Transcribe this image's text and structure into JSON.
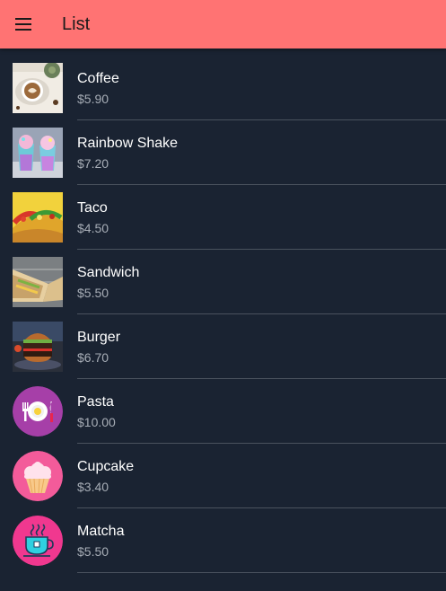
{
  "appbar": {
    "title": "List",
    "menu_icon": "hamburger-menu-icon",
    "background": "#ff7373"
  },
  "items": [
    {
      "name": "Coffee",
      "price": "$5.90",
      "thumb": "coffee-photo"
    },
    {
      "name": "Rainbow Shake",
      "price": "$7.20",
      "thumb": "rainbow-shake-photo"
    },
    {
      "name": "Taco",
      "price": "$4.50",
      "thumb": "taco-photo"
    },
    {
      "name": "Sandwich",
      "price": "$5.50",
      "thumb": "sandwich-photo"
    },
    {
      "name": "Burger",
      "price": "$6.70",
      "thumb": "burger-photo"
    },
    {
      "name": "Pasta",
      "price": "$10.00",
      "thumb": "plate-cutlery-icon"
    },
    {
      "name": "Cupcake",
      "price": "$3.40",
      "thumb": "cupcake-icon"
    },
    {
      "name": "Matcha",
      "price": "$5.50",
      "thumb": "tea-cup-icon"
    }
  ]
}
